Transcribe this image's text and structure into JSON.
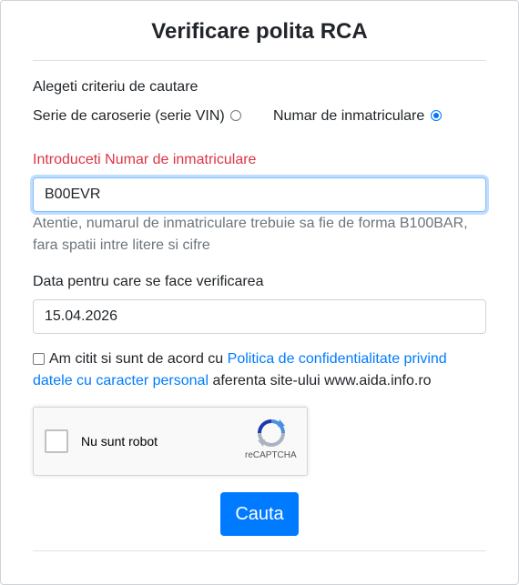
{
  "form": {
    "title": "Verificare polita RCA",
    "criteria_label": "Alegeti criteriu de cautare",
    "options": [
      {
        "label": "Serie de caroserie (serie VIN)",
        "selected": false
      },
      {
        "label": "Numar de inmatriculare",
        "selected": true
      }
    ],
    "plate_label": "Introduceti Numar de inmatriculare",
    "plate_value": "B00EVR",
    "plate_hint_line1": "Atentie, numarul de inmatriculare trebuie sa fie de forma B100BAR,",
    "plate_hint_line2": "fara spatii intre litere si cifre",
    "date_label": "Data pentru care se face verificarea",
    "date_value": "15.04.2026",
    "consent": {
      "prefix": "Am citit si sunt de acord cu ",
      "link_line1": "Politica de confidentialitate privind",
      "link_line2": "datele cu caracter personal",
      "suffix": " aferenta site-ului www.aida.info.ro",
      "checked": false
    },
    "captcha": {
      "label": "Nu sunt robot",
      "brand": "reCAPTCHA",
      "checked": false
    },
    "submit_label": "Cauta"
  },
  "colors": {
    "accent": "#007bff",
    "error": "#dc3545",
    "hint": "#6c757d"
  }
}
